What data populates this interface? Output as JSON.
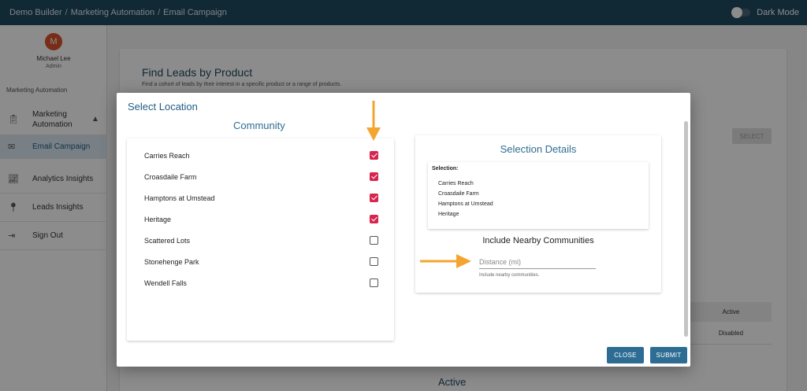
{
  "topbar": {
    "crumbs": [
      "Demo Builder",
      "Marketing Automation",
      "Email Campaign"
    ],
    "separator": "/",
    "dark_mode_label": "Dark Mode"
  },
  "sidebar": {
    "avatar_initial": "M",
    "user_name": "Michael Lee",
    "user_role": "Admin",
    "section_title": "Marketing Automation",
    "items": [
      {
        "label": "Marketing Automation",
        "icon": "clipboard-icon"
      },
      {
        "label": "Email Campaign",
        "icon": "mail-icon"
      },
      {
        "label": "Analytics Insights",
        "icon": "chart-icon"
      },
      {
        "label": "Leads Insights",
        "icon": "pin-icon"
      },
      {
        "label": "Sign Out",
        "icon": "sign-out-icon"
      }
    ]
  },
  "background": {
    "title": "Find Leads by Product",
    "subtitle": "Find a cohort of leads by their interest in a specific product or a range of products.",
    "select_label": "SELECT",
    "table_header": "Active",
    "table_cell": "Disabled",
    "bottom_heading": "Active"
  },
  "modal": {
    "title": "Select Location",
    "community_title": "Community",
    "communities": [
      {
        "name": "Carries Reach",
        "checked": true
      },
      {
        "name": "Croasdaile Farm",
        "checked": true
      },
      {
        "name": "Hamptons at Umstead",
        "checked": true
      },
      {
        "name": "Heritage",
        "checked": true
      },
      {
        "name": "Scattered Lots",
        "checked": false
      },
      {
        "name": "Stonehenge Park",
        "checked": false
      },
      {
        "name": "Wendell Falls",
        "checked": false
      }
    ],
    "details_title": "Selection Details",
    "selection_label": "Selection:",
    "selection_items": [
      "Carries Reach",
      "Croasdaile Farm",
      "Hamptons at Umstead",
      "Heritage"
    ],
    "nearby_title": "Include Nearby Communities",
    "distance_placeholder": "Distance (mi)",
    "distance_value": "",
    "distance_help": "Include nearby communities.",
    "close_label": "CLOSE",
    "submit_label": "SUBMIT"
  },
  "colors": {
    "accent": "#1f5d86",
    "checkbox_checked": "#d6254f",
    "annotation_arrow": "#f4a531",
    "topbar": "#1f4a62"
  }
}
